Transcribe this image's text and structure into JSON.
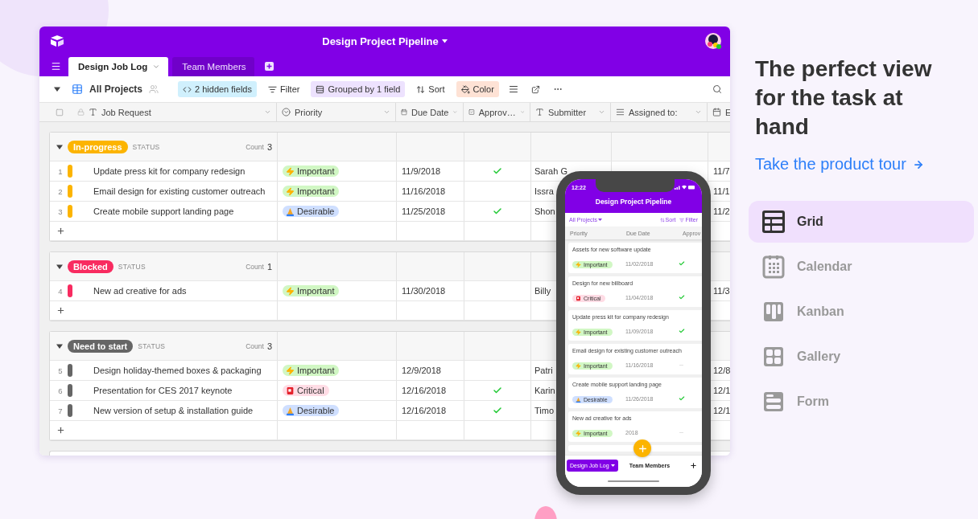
{
  "window": {
    "title": "Design Project Pipeline"
  },
  "tabs": [
    {
      "label": "Design Job Log",
      "selected": true
    },
    {
      "label": "Team Members",
      "selected": false
    }
  ],
  "toolbar": {
    "view": "All Projects",
    "hidden_fields": "2 hidden fields",
    "filter": "Filter",
    "grouped": "Grouped by 1 field",
    "sort": "Sort",
    "color_button": "Color",
    "all_selected": false
  },
  "columns": [
    {
      "label": "Job Request",
      "kind": "text"
    },
    {
      "label": "Priority",
      "kind": "select"
    },
    {
      "label": "Due Date",
      "kind": "date"
    },
    {
      "label": "Approv…",
      "kind": "checkbox"
    },
    {
      "label": "Submitter",
      "kind": "text"
    },
    {
      "label": "Assigned to:",
      "kind": "multi"
    },
    {
      "label": "E",
      "kind": "date"
    }
  ],
  "groups": [
    {
      "label": "In-progress",
      "color": "#fcb400",
      "field": "STATUS",
      "count_label": "Count",
      "count": "3",
      "rows": [
        {
          "number": "1",
          "job": "Update press kit for company redesign",
          "priority": {
            "label": "Important",
            "kind": "important"
          },
          "due": "11/9/2018",
          "approved": true,
          "submitter": "Sarah G",
          "column_7": "11/7"
        },
        {
          "number": "2",
          "job": "Email design for existing customer outreach",
          "priority": {
            "label": "Important",
            "kind": "important"
          },
          "due": "11/16/2018",
          "approved": false,
          "submitter": "Issra",
          "column_7": "11/1"
        },
        {
          "number": "3",
          "job": "Create mobile support landing page",
          "priority": {
            "label": "Desirable",
            "kind": "desirable"
          },
          "due": "11/25/2018",
          "approved": true,
          "submitter": "Shon",
          "column_7": "11/2"
        }
      ]
    },
    {
      "label": "Blocked",
      "color": "#f82b60",
      "field": "STATUS",
      "count_label": "Count",
      "count": "1",
      "rows": [
        {
          "number": "4",
          "job": "New ad creative for ads",
          "priority": {
            "label": "Important",
            "kind": "important"
          },
          "due": "11/30/2018",
          "approved": false,
          "submitter": "Billy",
          "column_7": "11/3"
        }
      ]
    },
    {
      "label": "Need to start",
      "color": "#666666",
      "field": "STATUS",
      "count_label": "Count",
      "count": "3",
      "rows": [
        {
          "number": "5",
          "job": "Design holiday-themed boxes & packaging",
          "priority": {
            "label": "Important",
            "kind": "important"
          },
          "due": "12/9/2018",
          "approved": false,
          "submitter": "Patri",
          "column_7": "12/8"
        },
        {
          "number": "6",
          "job": "Presentation for CES 2017 keynote",
          "priority": {
            "label": "Critical",
            "kind": "critical"
          },
          "due": "12/16/2018",
          "approved": true,
          "submitter": "Karin",
          "column_7": "12/1"
        },
        {
          "number": "7",
          "job": "New version of setup & installation guide",
          "priority": {
            "label": "Desirable",
            "kind": "desirable"
          },
          "due": "12/16/2018",
          "approved": true,
          "submitter": "Timo",
          "column_7": "12/1"
        }
      ]
    }
  ],
  "phone": {
    "time": "12:22",
    "title": "Design Project Pipeline",
    "view": "All Projects",
    "sort": "Sort",
    "filter": "Filter",
    "columns": [
      {
        "label": "Priority"
      },
      {
        "label": "Due Date"
      },
      {
        "label": "Approv"
      }
    ],
    "cards": [
      {
        "title": "Assets for new software update",
        "priority": {
          "label": "Important",
          "kind": "important"
        },
        "date": "11/02/2018",
        "approved": true
      },
      {
        "title": "Design for new billboard",
        "priority": {
          "label": "Critical",
          "kind": "critical"
        },
        "date": "11/04/2018",
        "approved": true
      },
      {
        "title": "Update press kit for company redesign",
        "priority": {
          "label": "Important",
          "kind": "important"
        },
        "date": "11/09/2018",
        "approved": true
      },
      {
        "title": "Email design for existing customer outreach",
        "priority": {
          "label": "Important",
          "kind": "important"
        },
        "date": "11/16/2018",
        "approved": false
      },
      {
        "title": "Create mobile support landing page",
        "priority": {
          "label": "Desirable",
          "kind": "desirable"
        },
        "date": "11/26/2018",
        "approved": true
      },
      {
        "title": "New ad creative for ads",
        "priority": {
          "label": "Important",
          "kind": "important"
        },
        "date": "2018",
        "approved": false
      }
    ],
    "tabs": [
      {
        "label": "Design Job Log",
        "selected": true
      },
      {
        "label": "Team Members",
        "selected": false
      }
    ]
  },
  "promo": {
    "heading": "The perfect view for the task at hand",
    "link": "Take the product tour"
  },
  "views": [
    {
      "label": "Grid",
      "kind": "grid",
      "selected": true
    },
    {
      "label": "Calendar",
      "kind": "calendar",
      "selected": false
    },
    {
      "label": "Kanban",
      "kind": "kanban",
      "selected": false
    },
    {
      "label": "Gallery",
      "kind": "gallery",
      "selected": false
    },
    {
      "label": "Form",
      "kind": "form",
      "selected": false
    }
  ]
}
